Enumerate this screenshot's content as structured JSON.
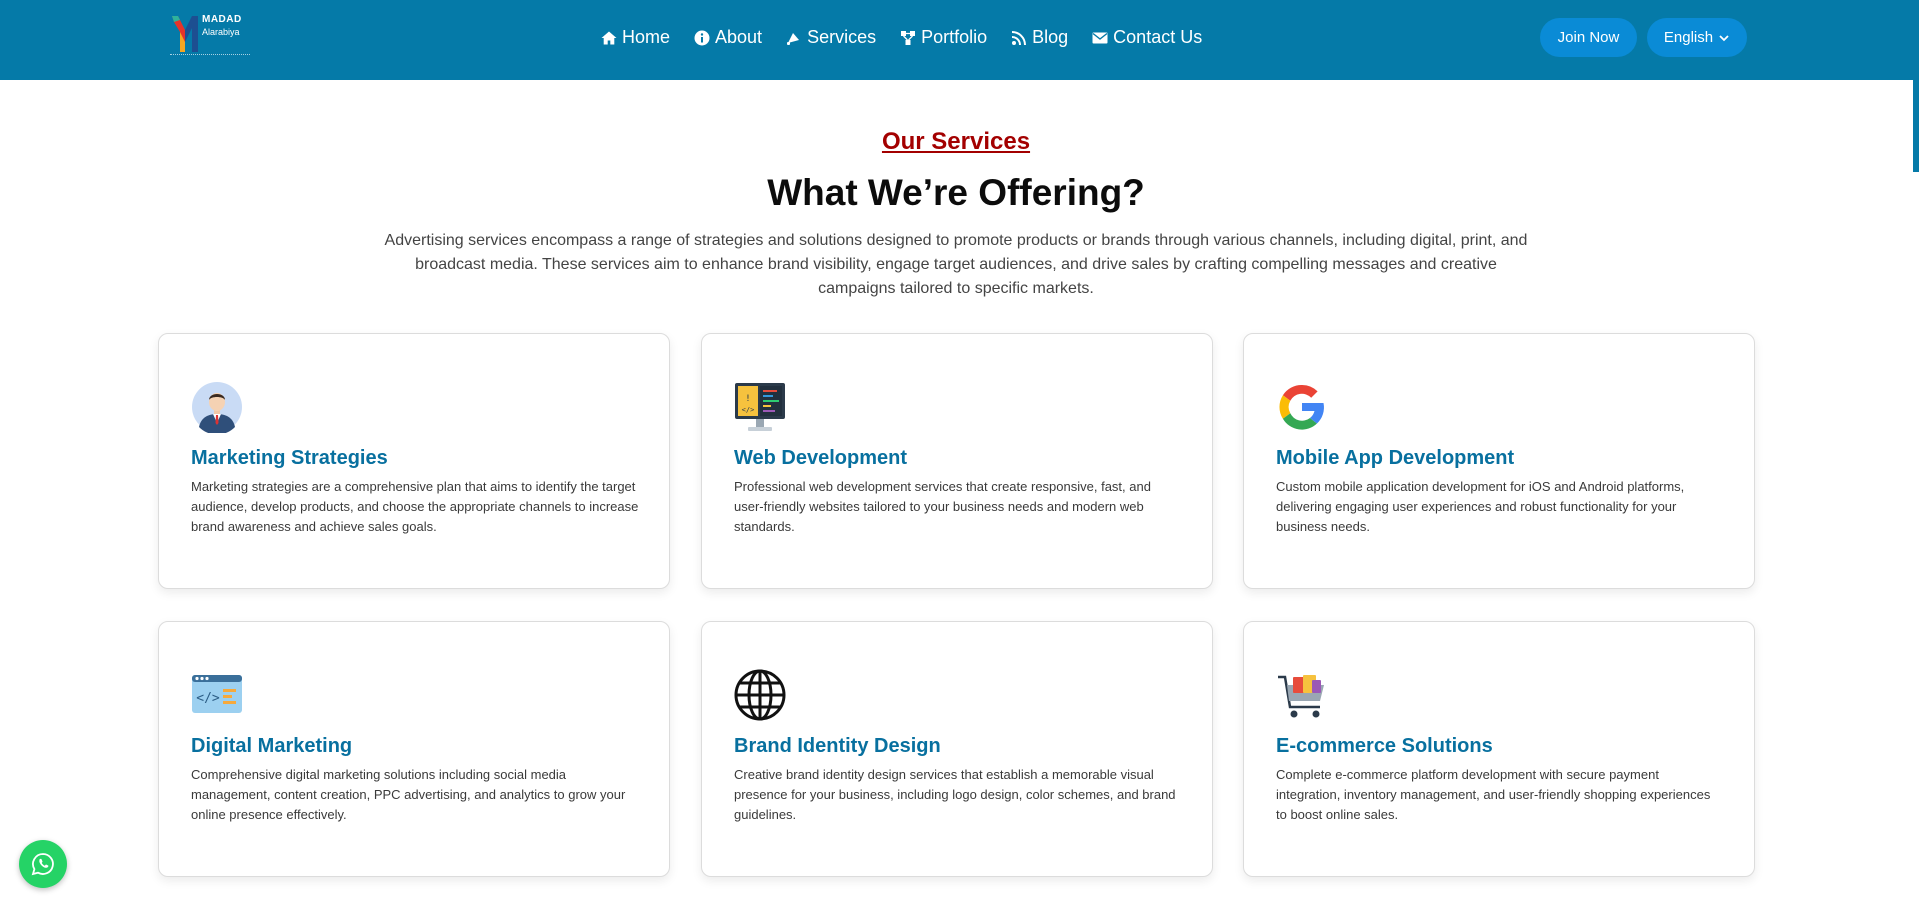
{
  "brand": {
    "name": "MADAD",
    "subname": "Alarabiya"
  },
  "nav": [
    {
      "label": "Home",
      "icon": "home-icon"
    },
    {
      "label": "About",
      "icon": "info-icon"
    },
    {
      "label": "Services",
      "icon": "services-icon"
    },
    {
      "label": "Portfolio",
      "icon": "portfolio-icon"
    },
    {
      "label": "Blog",
      "icon": "blog-icon"
    },
    {
      "label": "Contact Us",
      "icon": "mail-icon"
    }
  ],
  "header": {
    "join_label": "Join Now",
    "language_label": "English"
  },
  "section": {
    "eyebrow": "Our Services",
    "title": "What We’re Offering?",
    "intro": "Advertising services encompass a range of strategies and solutions designed to promote products or brands through various channels, including digital, print, and broadcast media. These services aim to enhance brand visibility, engage target audiences, and drive sales by crafting compelling messages and creative campaigns tailored to specific markets."
  },
  "services": [
    {
      "title": "Marketing Strategies",
      "icon": "businessman-icon",
      "desc": "Marketing strategies are a comprehensive plan that aims to identify the target audience, develop products, and choose the appropriate channels to increase brand awareness and achieve sales goals."
    },
    {
      "title": "Web Development",
      "icon": "code-monitor-icon",
      "desc": "Professional web development services that create responsive, fast, and user-friendly websites tailored to your business needs and modern web standards."
    },
    {
      "title": "Mobile App Development",
      "icon": "google-icon",
      "desc": "Custom mobile application development for iOS and Android platforms, delivering engaging user experiences and robust functionality for your business needs."
    },
    {
      "title": "Digital Marketing",
      "icon": "code-window-icon",
      "desc": "Comprehensive digital marketing solutions including social media management, content creation, PPC advertising, and analytics to grow your online presence effectively."
    },
    {
      "title": "Brand Identity Design",
      "icon": "globe-icon",
      "desc": "Creative brand identity design services that establish a memorable visual presence for your business, including logo design, color schemes, and brand guidelines."
    },
    {
      "title": "E-commerce Solutions",
      "icon": "shopping-cart-icon",
      "desc": "Complete e-commerce platform development with secure payment integration, inventory management, and user-friendly shopping experiences to boost online sales."
    }
  ],
  "colors": {
    "header_bg": "#057aa8",
    "accent_title": "#08709f",
    "eyebrow": "#a30000",
    "button": "#0a8bd6",
    "whatsapp": "#25d366"
  }
}
